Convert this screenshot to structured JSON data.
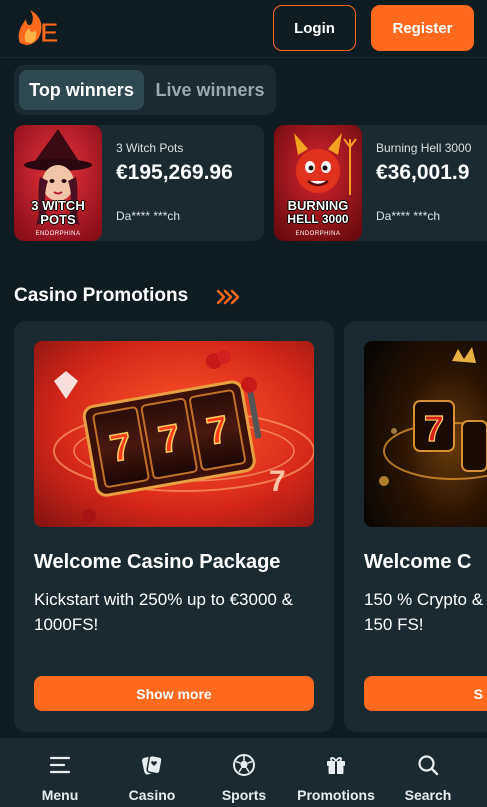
{
  "header": {
    "login_label": "Login",
    "register_label": "Register",
    "logo_text": "E"
  },
  "winners": {
    "tabs": [
      {
        "label": "Top winners",
        "active": true
      },
      {
        "label": "Live winners",
        "active": false
      }
    ],
    "items": [
      {
        "game": "3 Witch Pots",
        "amount": "€195,269.96",
        "user": "Da**** ***ch",
        "thumb_title_line1": "3 WITCH",
        "thumb_title_line2": "POTS",
        "thumb_brand": "ENDORPHINA"
      },
      {
        "game": "Burning Hell 3000",
        "amount": "€36,001.9",
        "user": "Da**** ***ch",
        "thumb_title_line1": "BURNING",
        "thumb_title_line2": "HELL 3000",
        "thumb_brand": "ENDORPHINA"
      }
    ]
  },
  "promotions": {
    "title": "Casino Promotions",
    "cards": [
      {
        "title": "Welcome Casino Package",
        "description": "Kickstart with 250% up to €3000 & 1000FS!",
        "button": "Show more"
      },
      {
        "title": "Welcome C",
        "description": "150 % Crypto & 150 FS!",
        "button": "S"
      }
    ]
  },
  "bottom_nav": {
    "items": [
      {
        "label": "Menu",
        "icon": "menu-icon"
      },
      {
        "label": "Casino",
        "icon": "casino-icon"
      },
      {
        "label": "Sports",
        "icon": "soccer-ball-icon"
      },
      {
        "label": "Promotions",
        "icon": "gift-icon"
      },
      {
        "label": "Search",
        "icon": "search-icon"
      }
    ]
  },
  "colors": {
    "accent": "#ff6a1f",
    "background": "#0f1c21",
    "card": "#1b2a30"
  }
}
